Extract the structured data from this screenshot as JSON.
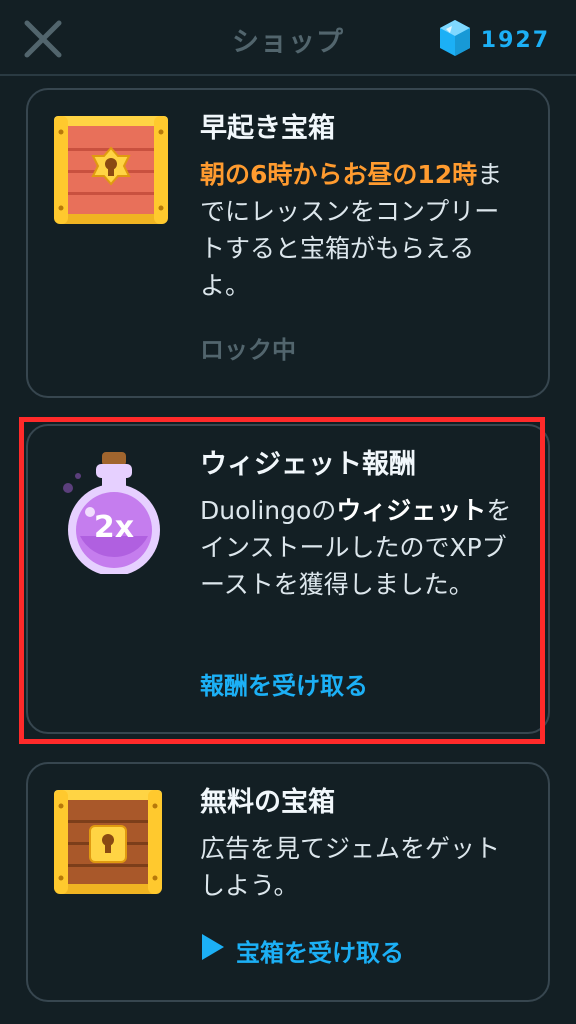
{
  "header": {
    "title": "ショップ",
    "gem_count": "1927"
  },
  "cards": [
    {
      "title": "早起き宝箱",
      "highlight": "朝の6時からお昼の12時",
      "desc": "までにレッスンをコンプリートすると宝箱がもらえるよ。",
      "status": "ロック中"
    },
    {
      "title": "ウィジェット報酬",
      "desc_pre": "Duolingoの",
      "desc_bold": "ウィジェット",
      "desc_post": "をインストールしたのでXPブーストを獲得しました。",
      "badge": "2x",
      "action": "報酬を受け取る"
    },
    {
      "title": "無料の宝箱",
      "desc": "広告を見てジェムをゲットしよう。",
      "action": "宝箱を受け取る"
    }
  ],
  "colors": {
    "background": "#131f24",
    "accent_blue": "#1cb0f6",
    "accent_orange": "#ff9b2f",
    "highlight_red": "#ff2a2a"
  }
}
